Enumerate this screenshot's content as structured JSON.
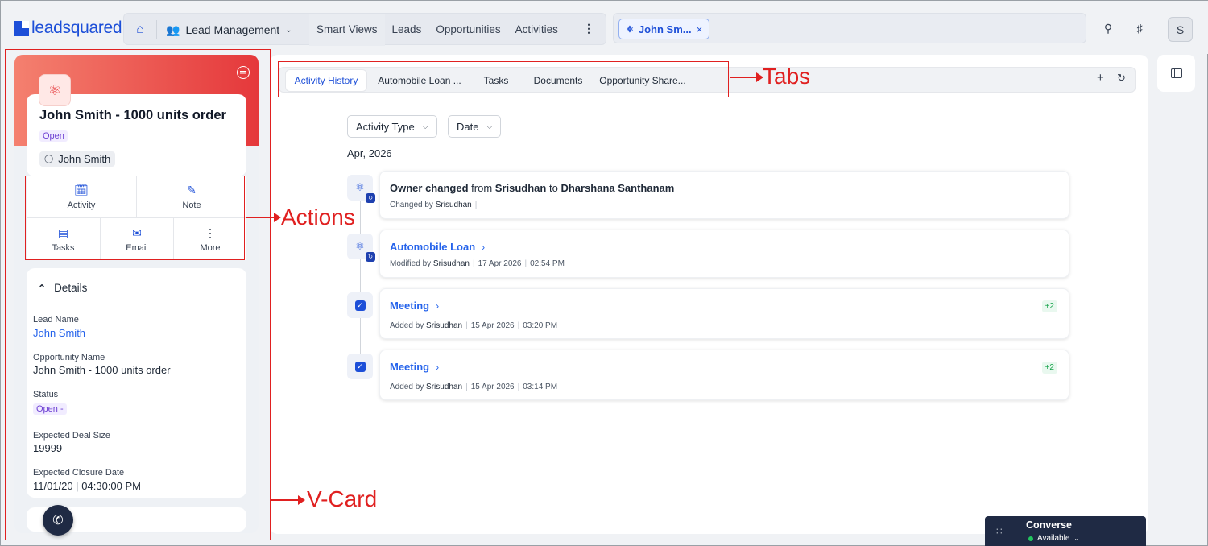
{
  "brand": {
    "logo_text": "leadsquared"
  },
  "nav": {
    "module": "Lead Management",
    "links": [
      "Smart Views",
      "Leads",
      "Opportunities",
      "Activities"
    ],
    "more": "⋮"
  },
  "search": {
    "chip_label": "John Sm...",
    "chip_close": "×"
  },
  "user": {
    "avatar_initial": "S"
  },
  "vcard": {
    "title": "John Smith - 1000 units order",
    "status": "Open",
    "owner": "John Smith",
    "actions": {
      "activity": "Activity",
      "note": "Note",
      "tasks": "Tasks",
      "email": "Email",
      "more": "More"
    },
    "details": {
      "heading": "Details",
      "lead_name_label": "Lead Name",
      "lead_name_value": "John Smith",
      "opportunity_name_label": "Opportunity Name",
      "opportunity_name_value": "John Smith - 1000 units order",
      "status_label": "Status",
      "status_value": "Open -",
      "deal_size_label": "Expected Deal Size",
      "deal_size_value": "19999",
      "closure_label": "Expected Closure Date",
      "closure_date": "11/01/20",
      "closure_time": "04:30:00 PM"
    }
  },
  "tabs": {
    "items": [
      "Activity History",
      "Automobile Loan ...",
      "Tasks",
      "Documents",
      "Opportunity Share..."
    ],
    "active_index": 0
  },
  "filters": {
    "activity_type": "Activity Type",
    "date": "Date"
  },
  "timeline": {
    "month": "Apr, 2026",
    "items": [
      {
        "title_pre": "Owner changed",
        "title_from_word": "from",
        "title_from": "Srisudhan",
        "title_to_word": "to",
        "title_to": "Dharshana Santhanam",
        "meta_verb": "Changed by",
        "meta_user": "Srisudhan"
      },
      {
        "title": "Automobile Loan",
        "meta_verb": "Modified by",
        "meta_user": "Srisudhan",
        "meta_date": "17 Apr 2026",
        "meta_time": "02:54 PM"
      },
      {
        "title": "Meeting",
        "meta_verb": "Added by",
        "meta_user": "Srisudhan",
        "meta_date": "15 Apr 2026",
        "meta_time": "03:20 PM",
        "badge": "+2"
      },
      {
        "title": "Meeting",
        "meta_verb": "Added by",
        "meta_user": "Srisudhan",
        "meta_date": "15 Apr 2026",
        "meta_time": "03:14 PM",
        "badge": "+2"
      }
    ]
  },
  "converse": {
    "title": "Converse",
    "status": "Available"
  },
  "annotations": {
    "tabs": "Tabs",
    "actions": "Actions",
    "vcard": "V-Card"
  },
  "colors": {
    "accent": "#1d4fd8",
    "hero_start": "#f4806f",
    "hero_end": "#e5383b",
    "annotation": "#e02020"
  }
}
